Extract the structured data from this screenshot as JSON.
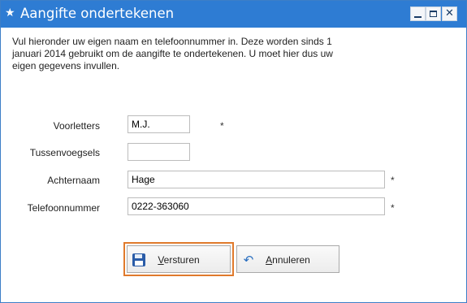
{
  "window": {
    "title": "Aangifte ondertekenen",
    "title_icon": "star-icon",
    "controls": {
      "minimize": "minimize-icon",
      "maximize": "maximize-icon",
      "close_glyph": "✕"
    }
  },
  "intro_text": "Vul hieronder uw eigen naam en telefoonnummer in. Deze worden sinds 1\njanuari 2014 gebruikt om de aangifte te ondertekenen. U moet hier dus uw\neigen gegevens invullen.",
  "form": {
    "voorletters": {
      "label": "Voorletters",
      "value": "M.J.",
      "required_mark": "*"
    },
    "tussenvoegsels": {
      "label": "Tussenvoegsels",
      "value": ""
    },
    "achternaam": {
      "label": "Achternaam",
      "value": "Hage",
      "required_mark": "*"
    },
    "telefoonnummer": {
      "label": "Telefoonnummer",
      "value": "0222-363060",
      "required_mark": "*"
    }
  },
  "buttons": {
    "versturen": {
      "label_first": "V",
      "label_rest": "ersturen",
      "icon": "floppy-disk-icon"
    },
    "annuleren": {
      "label_first": "A",
      "label_rest": "nnuleren",
      "icon": "undo-icon",
      "icon_glyph": "↶"
    }
  },
  "colors": {
    "titlebar": "#2e7cd3",
    "focus_ring": "#e07a2c"
  }
}
